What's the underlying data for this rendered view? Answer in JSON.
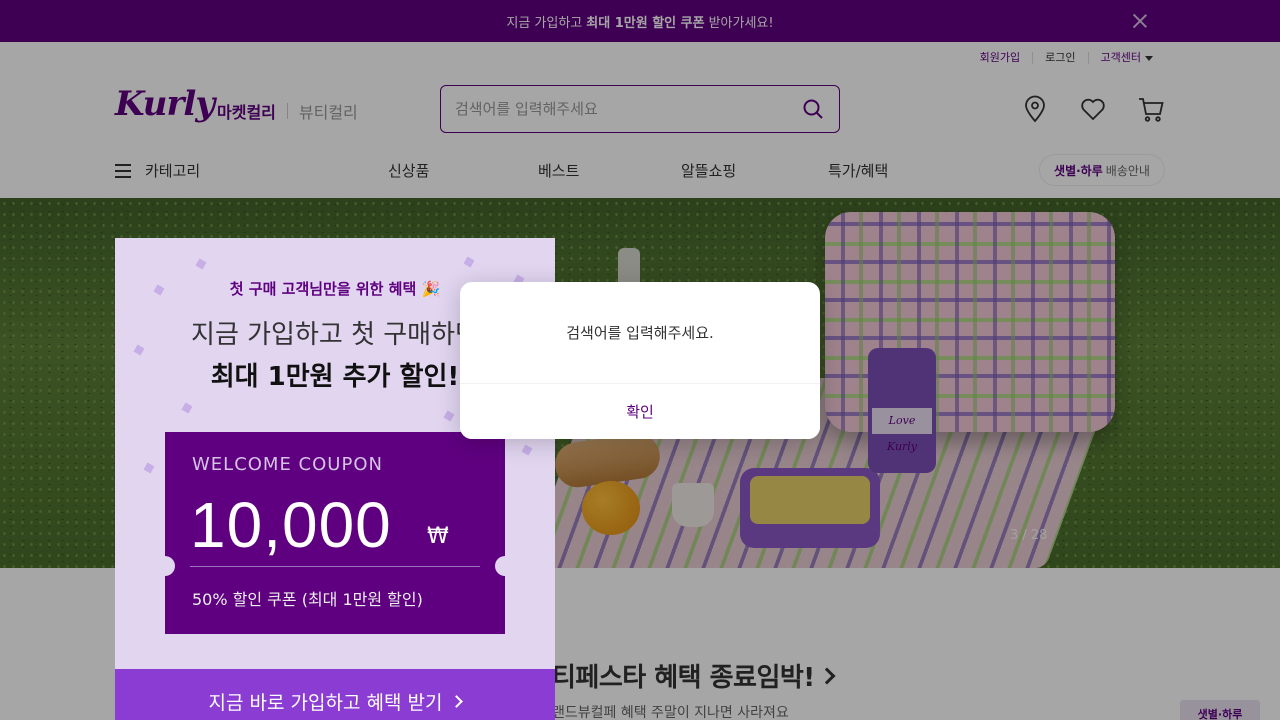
{
  "promo_bar": {
    "text_before": "지금 가입하고",
    "text_strong": "최대 1만원 할인 쿠폰",
    "text_after": "받아가세요!",
    "close_icon": "close-icon"
  },
  "utility_links": {
    "signup": "회원가입",
    "login": "로그인",
    "customer_center": "고객센터"
  },
  "header": {
    "logo": "Kurly",
    "market_tab": "마켓컬리",
    "beauty_tab": "뷰티컬리",
    "search_placeholder": "검색어를 입력해주세요",
    "search_value": "",
    "icons": [
      "map-pin-icon",
      "heart-icon",
      "cart-icon",
      "search-icon"
    ]
  },
  "nav": {
    "category": "카테고리",
    "items": [
      "신상품",
      "베스트",
      "알뜰쇼핑",
      "특가/혜택"
    ],
    "delivery_strong": "샛별·하루",
    "delivery_text": "배송안내"
  },
  "hero": {
    "slide_counter": "3 / 28",
    "tumbler_label": "Love Kurly"
  },
  "section": {
    "title": "티페스타 혜택 종료임박!",
    "subtitle": "랜드뷰컬페 혜택 주말이 지나면 사라져요",
    "side_thumb": "샛별·하루"
  },
  "coupon_card": {
    "eyebrow": "첫 구매 고객님만을 위한 혜택 🎉",
    "line1": "지금 가입하고 첫 구매하면",
    "line2": "최대 1만원 추가 할인!",
    "ticket_title": "WELCOME COUPON",
    "ticket_amount": "10,000",
    "ticket_currency": "₩",
    "ticket_desc": "50% 할인 쿠폰 (최대 1만원 할인)",
    "cta": "지금 바로 가입하고 혜택 받기"
  },
  "modal": {
    "message": "검색어를 입력해주세요.",
    "confirm": "확인"
  },
  "colors": {
    "brand": "#5f0080",
    "cta": "#8b3dd3",
    "card_bg": "#e1d5f0"
  }
}
